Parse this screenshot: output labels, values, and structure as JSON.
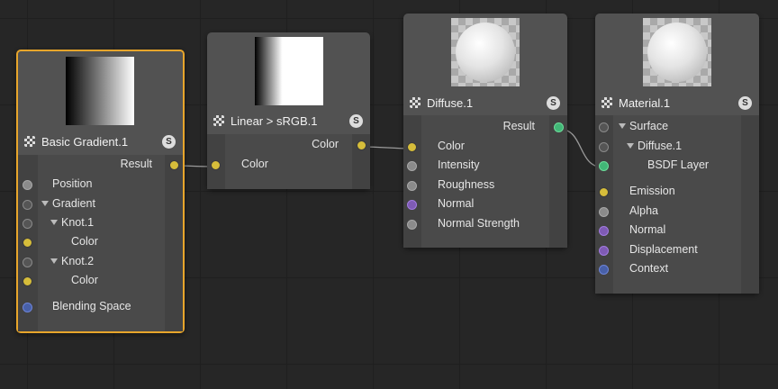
{
  "nodes": {
    "basic_gradient": {
      "title": "Basic Gradient.1",
      "output": "Result",
      "inputs": [
        "Position",
        "Gradient",
        "Knot.1",
        "Color",
        "Knot.2",
        "Color",
        "Blending Space"
      ]
    },
    "linear_srgb": {
      "title": "Linear > sRGB.1",
      "output": "Color",
      "input": "Color"
    },
    "diffuse": {
      "title": "Diffuse.1",
      "output": "Result",
      "inputs": [
        "Color",
        "Intensity",
        "Roughness",
        "Normal",
        "Normal Strength"
      ]
    },
    "material": {
      "title": "Material.1",
      "tree": [
        "Surface",
        "Diffuse.1",
        "BSDF Layer"
      ],
      "inputs": [
        "Emission",
        "Alpha",
        "Normal",
        "Displacement",
        "Context"
      ]
    }
  },
  "icons": {
    "node": "checker-icon",
    "solo": "s-icon",
    "solo_glyph": "S"
  },
  "colors": {
    "selected_border": "#e7a52b",
    "color_port": "#d6bd3a",
    "shader_port": "#42b777",
    "vector_port": "#7f5bb5",
    "context_port": "#4860a8"
  }
}
